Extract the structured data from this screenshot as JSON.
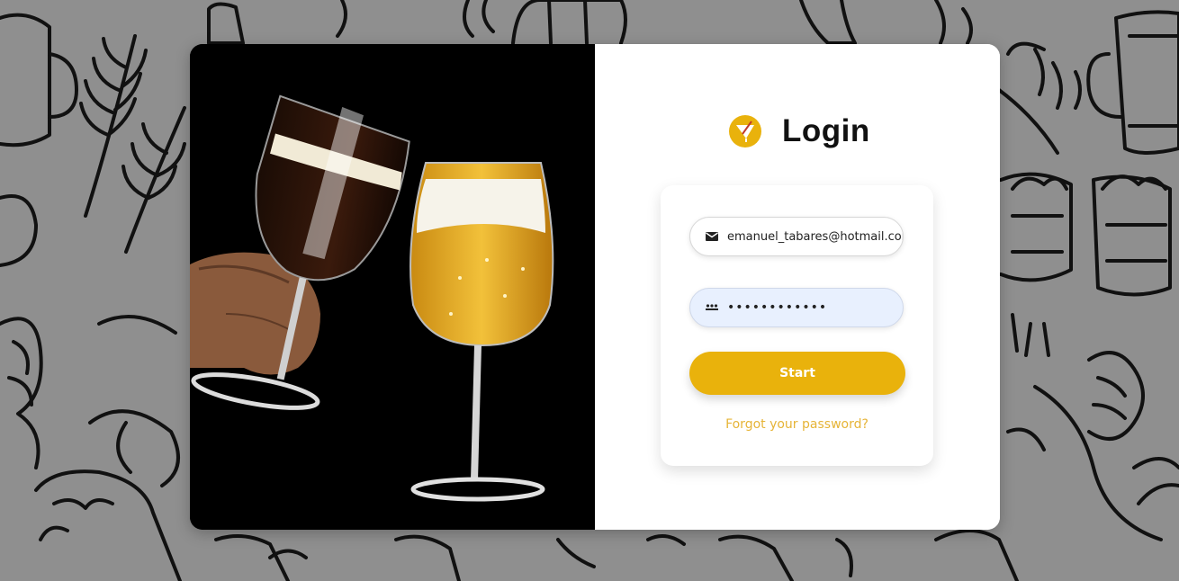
{
  "login": {
    "title": "Login",
    "email_value": "emanuel_tabares@hotmail.com",
    "password_value": "••••••••••••",
    "start_label": "Start",
    "forgot_label": "Forgot your password?"
  },
  "icons": {
    "logo": "beer-glass-logo-icon",
    "email": "mail-icon",
    "password": "password-dots-icon"
  },
  "colors": {
    "background": "#8f8f8f",
    "accent": "#e9b20c",
    "link": "#e6b437",
    "password_field_bg": "#e8f0fe",
    "photo_bg": "#000000"
  }
}
